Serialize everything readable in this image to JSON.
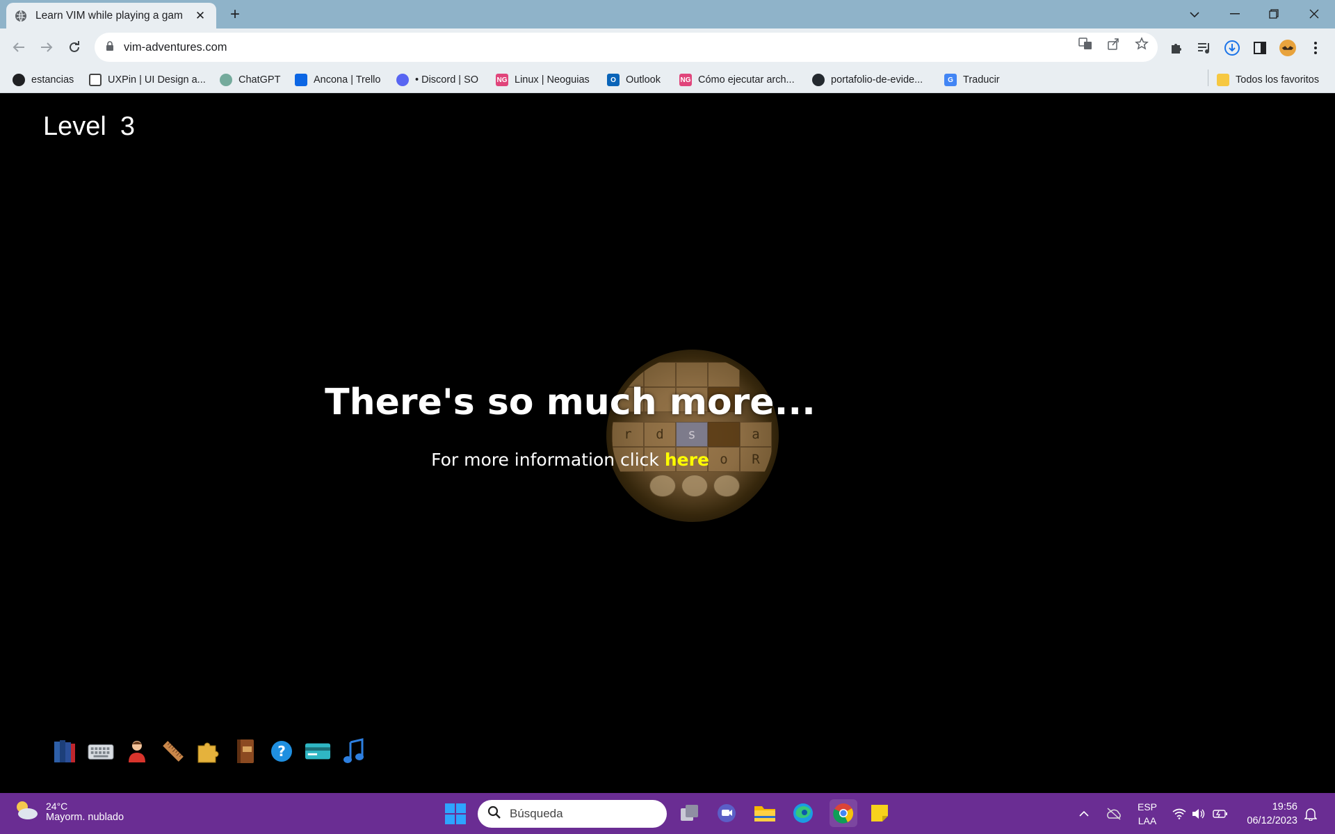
{
  "browser": {
    "tab_title": "Learn VIM while playing a game",
    "url": "vim-adventures.com",
    "bookmarks": [
      {
        "label": "estancias"
      },
      {
        "label": "UXPin | UI Design a..."
      },
      {
        "label": "ChatGPT"
      },
      {
        "label": "Ancona | Trello"
      },
      {
        "label": "• Discord | SO"
      },
      {
        "label": "Linux | Neoguias"
      },
      {
        "label": "Outlook"
      },
      {
        "label": "Cómo ejecutar arch..."
      },
      {
        "label": "portafolio-de-evide..."
      },
      {
        "label": "Traducir"
      }
    ],
    "all_bookmarks": "Todos los favoritos"
  },
  "game": {
    "level_label": "Level",
    "level_number": "3",
    "headline": "There's so much more...",
    "info_prefix": "For more information click",
    "info_link": "here",
    "tile_letters": [
      "r",
      "d",
      "s",
      "a",
      "o",
      "R"
    ],
    "inventory": [
      "book-icon",
      "keyboard-icon",
      "character-icon",
      "ruler-icon",
      "puzzle-icon",
      "law-book-icon",
      "help-icon",
      "card-icon",
      "music-icon"
    ]
  },
  "taskbar": {
    "temperature": "24°C",
    "weather": "Mayorm. nublado",
    "search_placeholder": "Búsqueda",
    "lang_line1": "ESP",
    "lang_line2": "LAA",
    "time": "19:56",
    "date": "06/12/2023"
  },
  "colors": {
    "titlebar": "#8fb3c9",
    "toolbar": "#e9eef2",
    "game_bg": "#000000",
    "link": "#ffff00",
    "taskbar": "#6a2d93"
  }
}
